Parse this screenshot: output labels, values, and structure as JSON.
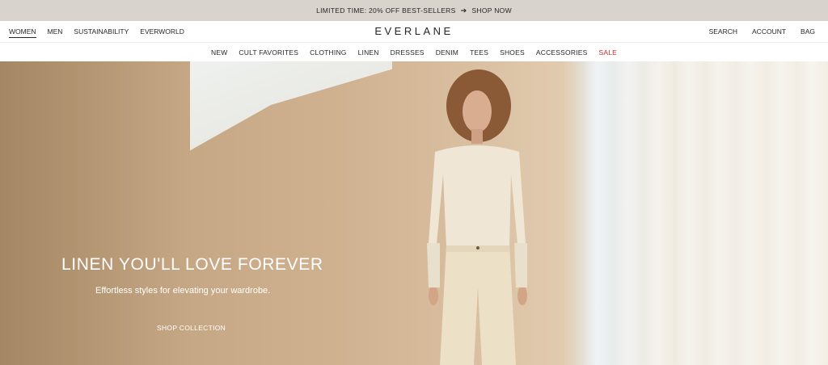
{
  "promo": {
    "text": "LIMITED TIME: 20% OFF BEST-SELLERS",
    "arrow": "➔",
    "link": "SHOP NOW"
  },
  "header": {
    "logo": "EVERLANE",
    "left_nav": [
      "WOMEN",
      "MEN",
      "SUSTAINABILITY",
      "EVERWORLD"
    ],
    "active_left": "WOMEN",
    "right_nav": [
      "SEARCH",
      "ACCOUNT",
      "BAG"
    ]
  },
  "categories": [
    "NEW",
    "CULT FAVORITES",
    "CLOTHING",
    "LINEN",
    "DRESSES",
    "DENIM",
    "TEES",
    "SHOES",
    "ACCESSORIES",
    "SALE"
  ],
  "hero": {
    "title": "LINEN YOU'LL LOVE FOREVER",
    "subtitle": "Effortless styles for elevating your wardrobe.",
    "cta": "SHOP COLLECTION"
  },
  "colors": {
    "promo_bg": "#d9d3cd",
    "sale": "#c52b2b",
    "text": "#262626"
  }
}
